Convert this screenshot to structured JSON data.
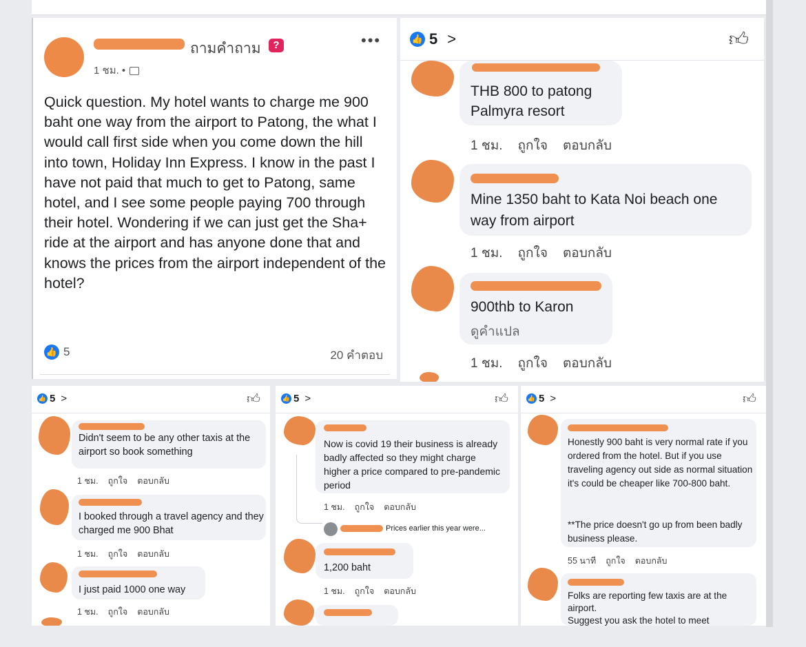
{
  "post": {
    "asks_label": "ถามคำถาม",
    "question_badge": "?",
    "more_label": "•••",
    "time": "1 ชม. •",
    "body": "Quick question.  My hotel wants to charge me 900 baht one way from the airport to Patong, the what I would call first side when you come down the hill into town, Holiday Inn Express.  I know in the past I have not paid that much to get to Patong, same hotel, and I see some people paying 700 through their hotel. Wondering if we can just get the Sha+ ride at the airport and has anyone done that and knows the prices from the airport independent of the hotel?",
    "like_count": "5",
    "comment_count": "20 คำตอบ"
  },
  "reactions": {
    "count": "5",
    "chevron": ">"
  },
  "actions": {
    "like": "ถูกใจ",
    "reply": "ตอบกลับ"
  },
  "big_comments": [
    {
      "text": "THB 800 to patong Palmyra resort",
      "time": "1 ชม."
    },
    {
      "text": "Mine 1350 baht to Kata Noi beach one way from airport",
      "time": "1 ชม."
    },
    {
      "text": "900thb to Karon",
      "translate": "ดูคำแปล",
      "time": "1 ชม."
    }
  ],
  "panel1": [
    {
      "text": "Didn't seem to be any other taxis at the airport so book something",
      "time": "1 ชม."
    },
    {
      "text": "I booked through a travel agency and they charged me 900 Bhat",
      "time": "1 ชม."
    },
    {
      "text": "I just paid 1000 one way",
      "time": "1 ชม."
    }
  ],
  "panel2": [
    {
      "text": "Now is covid 19 their business is already badly affected so they might charge higher a price compared to pre-pandemic period",
      "time": "1 ชม."
    },
    {
      "reply_preview": "Prices earlier this year were..."
    },
    {
      "text": "1,200 baht",
      "time": "1 ชม."
    }
  ],
  "panel3": [
    {
      "text": "Honestly 900 baht is very normal rate if you ordered from the hotel.  But if you use traveling agency out side as normal situation it's could be cheaper like 700-800 baht.",
      "text2": "**The price doesn't go up from been badly business please.",
      "time": "55 นาที"
    },
    {
      "text": "Folks are reporting few taxis are at the airport.",
      "text2": "Suggest you ask the hotel to meet"
    }
  ],
  "colors": {
    "like_blue": "#1877f2",
    "redaction": "#ee8a48",
    "bubble": "#f0f2f5"
  }
}
